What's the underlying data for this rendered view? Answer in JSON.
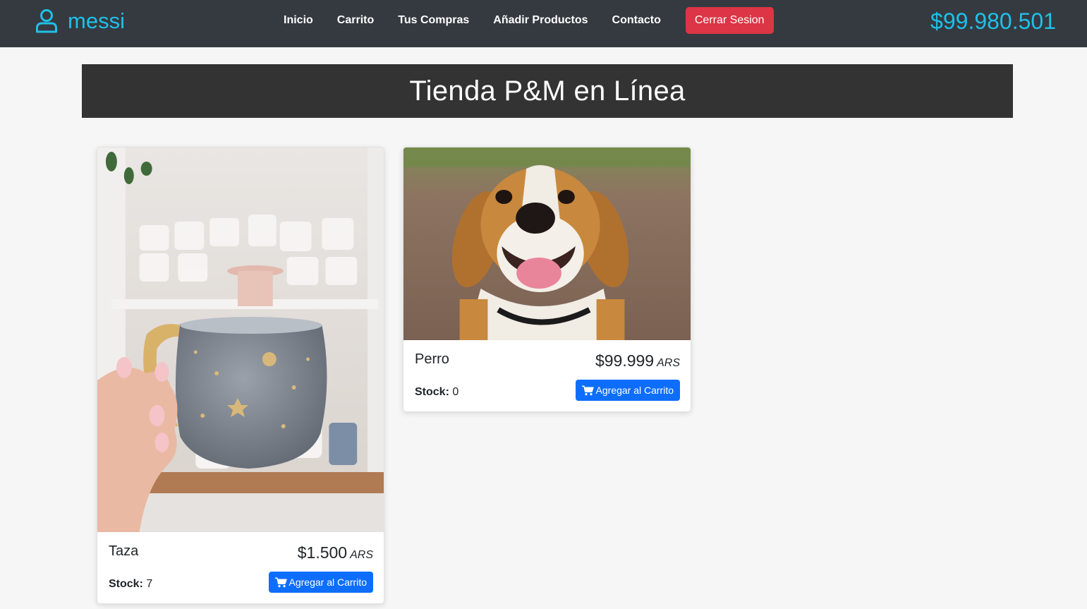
{
  "navbar": {
    "user_icon": "user-icon",
    "username": "messi",
    "links": [
      "Inicio",
      "Carrito",
      "Tus Compras",
      "Añadir Productos",
      "Contacto"
    ],
    "logout_label": "Cerrar Sesion",
    "balance": "$99.980.501",
    "brand_color": "#1fc0e8",
    "logout_color": "#dc3545"
  },
  "banner": {
    "title": "Tienda P&M en Línea"
  },
  "products": [
    {
      "name": "Taza",
      "price": "$1.500",
      "currency": "ARS",
      "stock_label": "Stock:",
      "stock": "7",
      "button_label": "Agregar al Carrito",
      "image": "mug-photo"
    },
    {
      "name": "Perro",
      "price": "$99.999",
      "currency": "ARS",
      "stock_label": "Stock:",
      "stock": "0",
      "button_label": "Agregar al Carrito",
      "image": "dog-photo"
    }
  ],
  "cart_icon": "cart-icon",
  "button_color": "#0d6efd"
}
